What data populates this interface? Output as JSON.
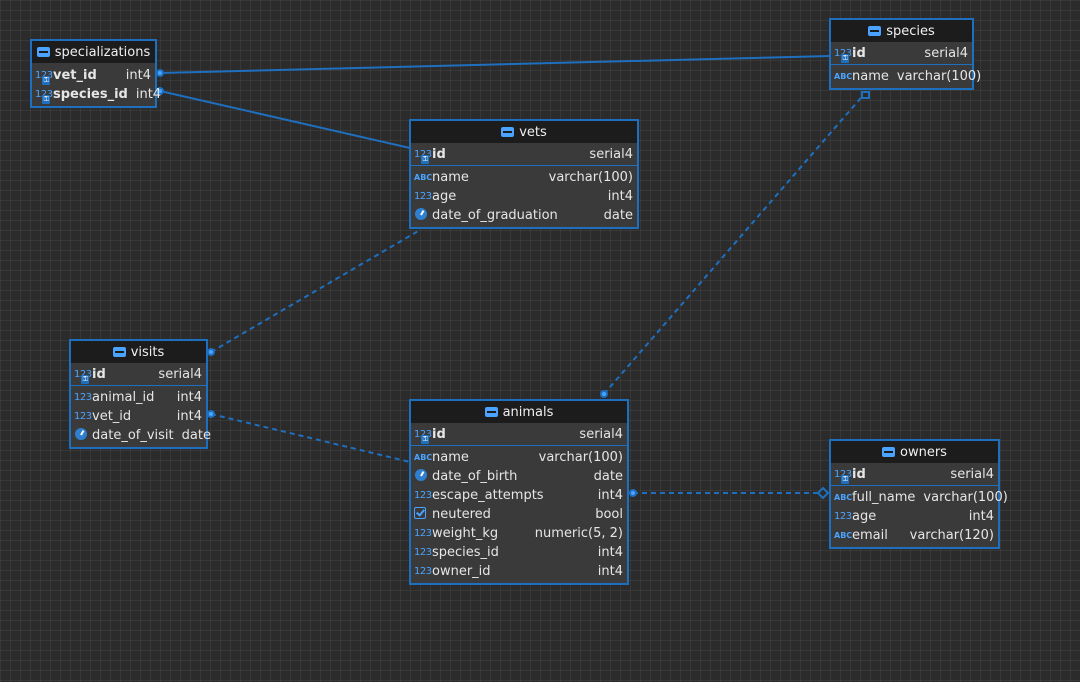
{
  "tables": {
    "specializations": {
      "title": "specializations",
      "columns": [
        {
          "name": "vet_id",
          "type": "int4",
          "icon": "numeric-key-icon",
          "key": true
        },
        {
          "name": "species_id",
          "type": "int4",
          "icon": "numeric-key-icon",
          "key": true
        }
      ]
    },
    "species": {
      "title": "species",
      "pk": {
        "name": "id",
        "type": "serial4",
        "icon": "numeric-key-icon"
      },
      "columns": [
        {
          "name": "name",
          "type": "varchar(100)",
          "icon": "text-icon"
        }
      ]
    },
    "vets": {
      "title": "vets",
      "pk": {
        "name": "id",
        "type": "serial4",
        "icon": "numeric-key-icon"
      },
      "columns": [
        {
          "name": "name",
          "type": "varchar(100)",
          "icon": "text-icon"
        },
        {
          "name": "age",
          "type": "int4",
          "icon": "numeric-icon"
        },
        {
          "name": "date_of_graduation",
          "type": "date",
          "icon": "clock-icon"
        }
      ]
    },
    "visits": {
      "title": "visits",
      "pk": {
        "name": "id",
        "type": "serial4",
        "icon": "numeric-key-icon"
      },
      "columns": [
        {
          "name": "animal_id",
          "type": "int4",
          "icon": "numeric-icon"
        },
        {
          "name": "vet_id",
          "type": "int4",
          "icon": "numeric-icon"
        },
        {
          "name": "date_of_visit",
          "type": "date",
          "icon": "clock-icon"
        }
      ]
    },
    "animals": {
      "title": "animals",
      "pk": {
        "name": "id",
        "type": "serial4",
        "icon": "numeric-key-icon"
      },
      "columns": [
        {
          "name": "name",
          "type": "varchar(100)",
          "icon": "text-icon"
        },
        {
          "name": "date_of_birth",
          "type": "date",
          "icon": "clock-icon"
        },
        {
          "name": "escape_attempts",
          "type": "int4",
          "icon": "numeric-icon"
        },
        {
          "name": "neutered",
          "type": "bool",
          "icon": "checkbox-icon"
        },
        {
          "name": "weight_kg",
          "type": "numeric(5, 2)",
          "icon": "numeric-icon"
        },
        {
          "name": "species_id",
          "type": "int4",
          "icon": "numeric-icon"
        },
        {
          "name": "owner_id",
          "type": "int4",
          "icon": "numeric-icon"
        }
      ]
    },
    "owners": {
      "title": "owners",
      "pk": {
        "name": "id",
        "type": "serial4",
        "icon": "numeric-key-icon"
      },
      "columns": [
        {
          "name": "full_name",
          "type": "varchar(100)",
          "icon": "text-icon"
        },
        {
          "name": "age",
          "type": "int4",
          "icon": "numeric-icon"
        },
        {
          "name": "email",
          "type": "varchar(120)",
          "icon": "text-icon"
        }
      ]
    }
  },
  "relations": [
    {
      "from": "specializations",
      "to": "species",
      "style": "solid"
    },
    {
      "from": "specializations",
      "to": "vets",
      "style": "solid"
    },
    {
      "from": "visits",
      "to": "vets",
      "style": "dashed"
    },
    {
      "from": "visits",
      "to": "animals",
      "style": "dashed"
    },
    {
      "from": "animals",
      "to": "species",
      "style": "dashed"
    },
    {
      "from": "animals",
      "to": "owners",
      "style": "dashed"
    }
  ],
  "colors": {
    "accent": "#1f6fbf",
    "icon": "#4aa3ff",
    "background": "#2b2b2b"
  },
  "icons": {
    "table": "table-icon",
    "text": "ABC",
    "numeric": "123"
  }
}
